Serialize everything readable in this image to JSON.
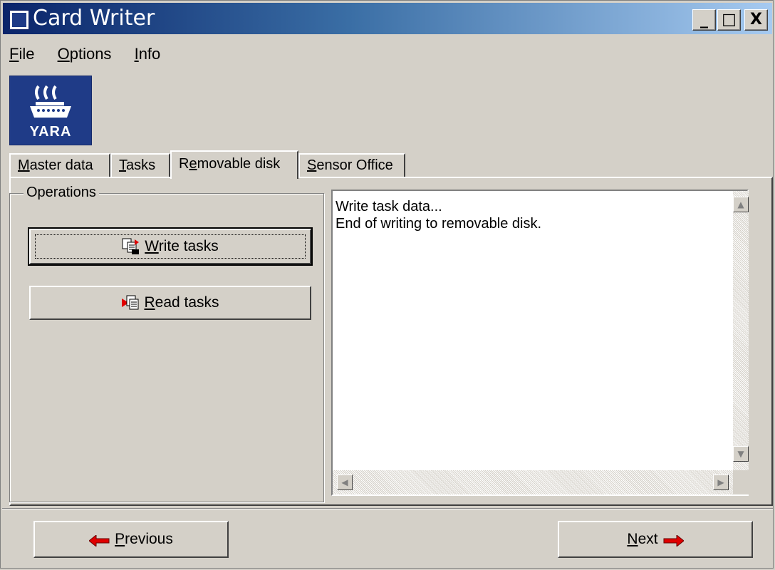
{
  "window": {
    "title": "Card Writer",
    "controls": {
      "minimize": "_",
      "maximize": "□",
      "close": "X"
    }
  },
  "menu": [
    {
      "label": "File",
      "mnemonic": "F",
      "rest": "ile"
    },
    {
      "label": "Options",
      "mnemonic": "O",
      "rest": "ptions"
    },
    {
      "label": "Info",
      "mnemonic": "I",
      "rest": "nfo"
    }
  ],
  "logo": {
    "text": "YARA"
  },
  "tabs": [
    {
      "mn": "M",
      "rest": "aster data",
      "pre": ""
    },
    {
      "mn": "T",
      "rest": "asks",
      "pre": ""
    },
    {
      "mn": "e",
      "rest": "movable disk",
      "pre": "R"
    },
    {
      "mn": "S",
      "rest": "ensor Office",
      "pre": ""
    }
  ],
  "active_tab": "Removable disk",
  "operations": {
    "group_label": "Operations",
    "write_button": {
      "mn": "W",
      "rest": "rite tasks"
    },
    "read_button": {
      "mn": "R",
      "rest": "ead tasks"
    }
  },
  "log": {
    "lines": [
      "Write task data...",
      "End of writing to removable disk."
    ]
  },
  "navigation": {
    "previous": {
      "mn": "P",
      "rest": "revious"
    },
    "next": {
      "mn": "N",
      "rest": "ext"
    }
  },
  "colors": {
    "title_gradient_start": "#0a246a",
    "title_gradient_end": "#a6caf0",
    "face": "#d4d0c8",
    "logo_blue": "#1f3b87",
    "arrow_red": "#e00000"
  }
}
